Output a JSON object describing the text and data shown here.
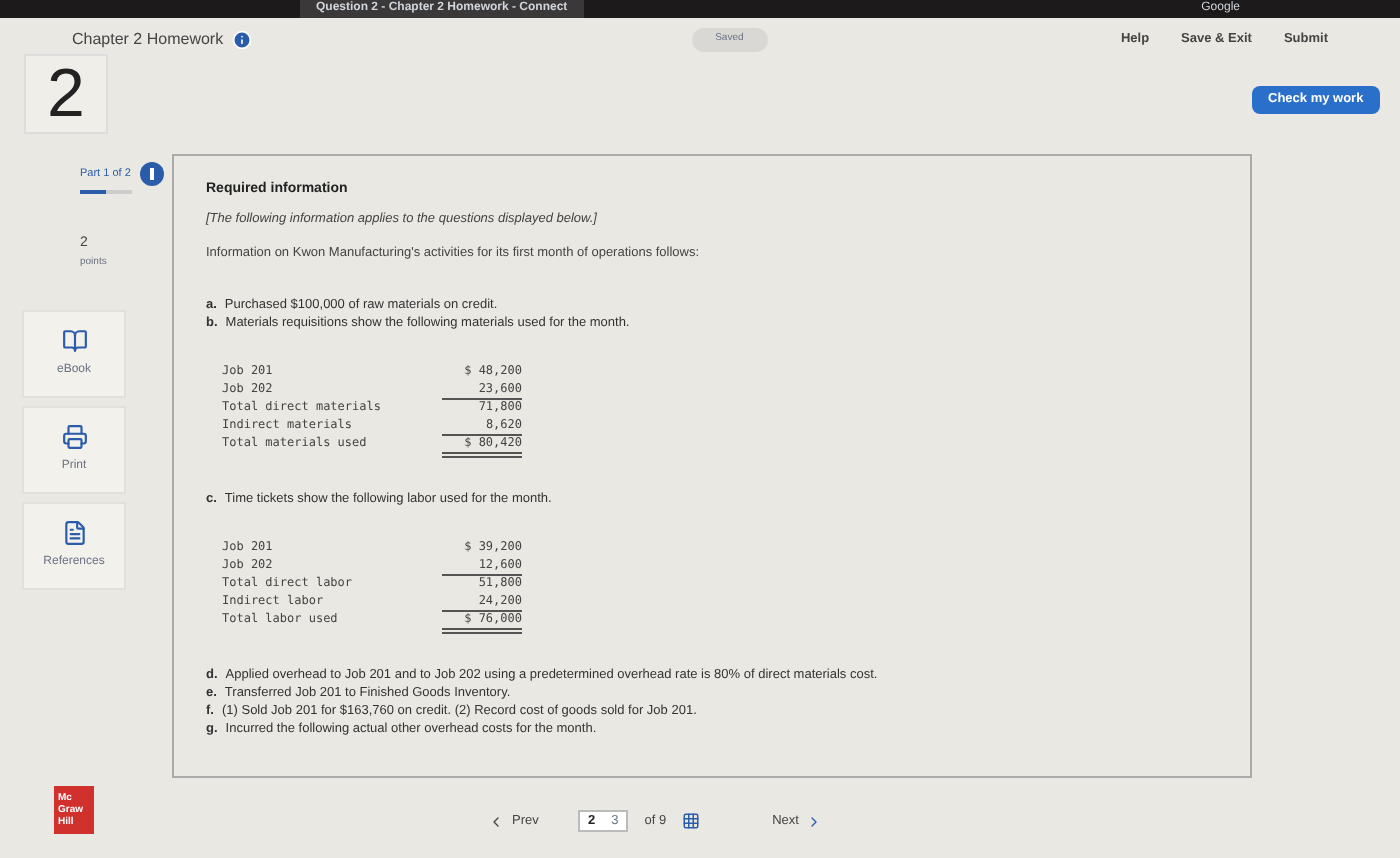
{
  "browser": {
    "tab_title": "Question 2 - Chapter 2 Homework - Connect",
    "account": "Google"
  },
  "header": {
    "title": "Chapter 2 Homework",
    "saved": "Saved",
    "links": [
      "Help",
      "Save & Exit",
      "Submit"
    ],
    "check_button": "Check my work"
  },
  "question": {
    "number": "2",
    "part": "Part 1 of 2",
    "level": 0.5,
    "points_value": "2",
    "points_label": "points"
  },
  "tools": [
    {
      "kind": "book",
      "label": "eBook"
    },
    {
      "kind": "print",
      "label": "Print"
    },
    {
      "kind": "doc",
      "label": "References"
    }
  ],
  "content": {
    "heading": "Required information",
    "note": "[The following information applies to the questions displayed below.]",
    "intro": "Information on Kwon Manufacturing's activities for its first month of operations follows:",
    "items_1": [
      {
        "letter": "a.",
        "text": "Purchased $100,000 of raw materials on credit."
      },
      {
        "letter": "b.",
        "text": "Materials requisitions show the following materials used for the month."
      }
    ],
    "table_1": [
      {
        "label": "Job 201",
        "amount": "$ 48,200",
        "kind": "plain"
      },
      {
        "label": "Job 202",
        "amount": "23,600",
        "kind": "ruled"
      },
      {
        "label": "Total direct materials",
        "amount": "71,800",
        "kind": "plain"
      },
      {
        "label": "Indirect materials",
        "amount": "8,620",
        "kind": "ruled"
      },
      {
        "label": "Total materials used",
        "amount": "$ 80,420",
        "kind": "total"
      }
    ],
    "items_2": [
      {
        "letter": "c.",
        "text": "Time tickets show the following labor used for the month."
      }
    ],
    "table_2": [
      {
        "label": "Job 201",
        "amount": "$ 39,200",
        "kind": "plain"
      },
      {
        "label": "Job 202",
        "amount": "12,600",
        "kind": "ruled"
      },
      {
        "label": "Total direct labor",
        "amount": "51,800",
        "kind": "plain"
      },
      {
        "label": "Indirect labor",
        "amount": "24,200",
        "kind": "ruled"
      },
      {
        "label": "Total labor used",
        "amount": "$ 76,000",
        "kind": "total"
      }
    ],
    "items_3": [
      {
        "letter": "d.",
        "text": "Applied overhead to Job 201 and to Job 202 using a predetermined overhead rate is 80% of direct materials cost."
      },
      {
        "letter": "e.",
        "text": "Transferred Job 201 to Finished Goods Inventory."
      },
      {
        "letter": "f.",
        "text": "(1) Sold Job 201 for $163,760 on credit. (2) Record cost of goods sold for Job 201."
      },
      {
        "letter": "g.",
        "text": "Incurred the following actual other overhead costs for the month."
      }
    ]
  },
  "footer": {
    "logo": [
      "Mc",
      "Graw",
      "Hill"
    ],
    "prev": "Prev",
    "pages": [
      {
        "label": "2",
        "selected": true
      },
      {
        "label": "3",
        "selected": false
      }
    ],
    "of": "of 9",
    "next": "Next"
  }
}
